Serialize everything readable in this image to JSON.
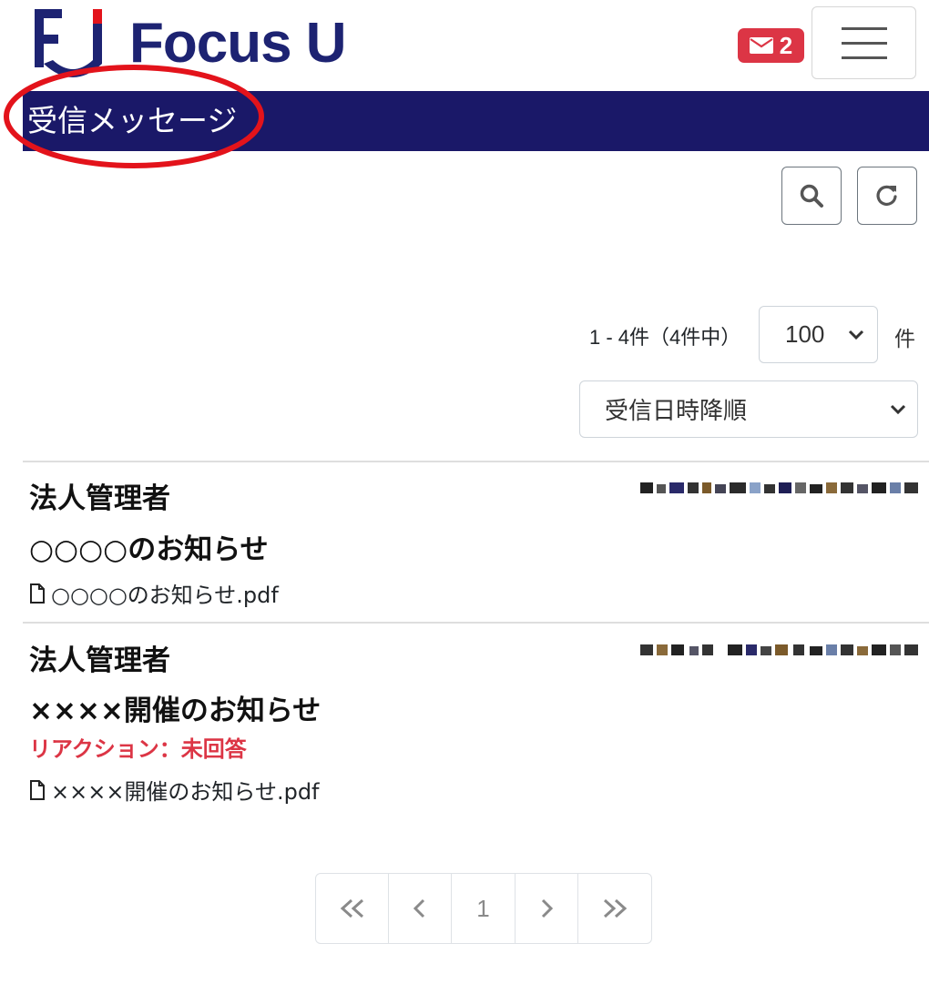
{
  "header": {
    "logo_text": "Focus U",
    "unread_count": "2"
  },
  "page": {
    "title": "受信メッセージ"
  },
  "list_controls": {
    "count_text": "1 - 4件（4件中）",
    "per_page_value": "100",
    "per_page_unit": "件",
    "sort_value": "受信日時降順"
  },
  "messages": [
    {
      "sender": "法人管理者",
      "subject": "○○○○のお知らせ",
      "attachment": "○○○○のお知らせ.pdf"
    },
    {
      "sender": "法人管理者",
      "subject": "××××開催のお知らせ",
      "reaction": "リアクション：未回答",
      "attachment": "××××開催のお知らせ.pdf"
    }
  ],
  "pagination": {
    "first": "«",
    "prev": "‹",
    "current": "1",
    "next": "›",
    "last": "»"
  },
  "colors": {
    "brand": "#1d2372",
    "title_bar": "#1a1868",
    "badge": "#dc3545",
    "highlight": "#e3131b"
  }
}
